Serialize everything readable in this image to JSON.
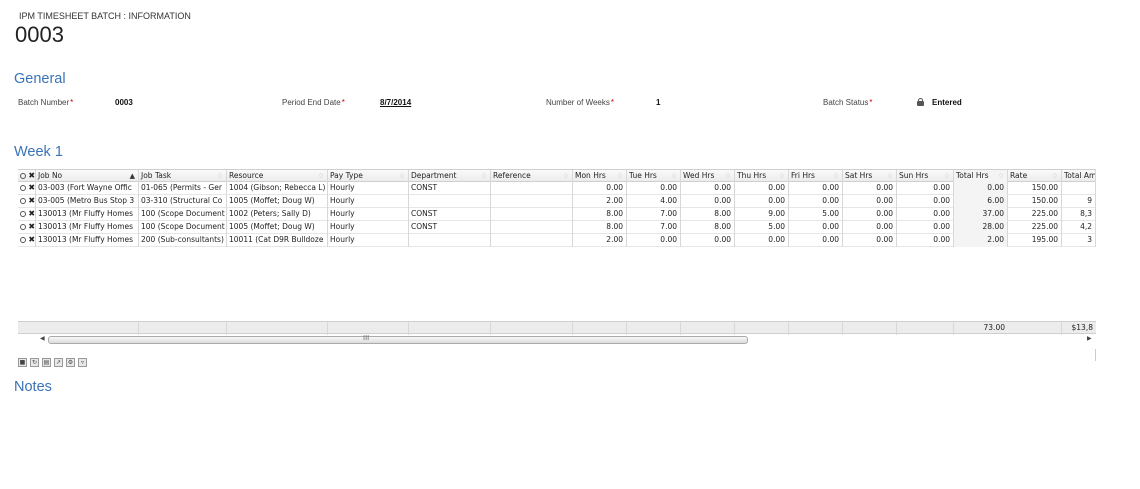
{
  "header": {
    "subtitle": "IPM TIMESHEET BATCH : INFORMATION",
    "title": "0003"
  },
  "general": {
    "section_title": "General",
    "batch_number_label": "Batch Number",
    "batch_number_value": "0003",
    "period_end_label": "Period End Date",
    "period_end_value": "8/7/2014",
    "weeks_label": "Number of Weeks",
    "weeks_value": "1",
    "status_label": "Batch Status",
    "status_value": "Entered",
    "required_marker": "*",
    "status_icon": "lock-icon"
  },
  "week": {
    "section_title": "Week 1",
    "columns": [
      "Job No",
      "Job Task",
      "Resource",
      "Pay Type",
      "Department",
      "Reference",
      "Mon Hrs",
      "Tue Hrs",
      "Wed Hrs",
      "Thu Hrs",
      "Fri Hrs",
      "Sat Hrs",
      "Sun Hrs",
      "Total Hrs",
      "Rate",
      "Total Am"
    ],
    "rows": [
      {
        "job_no": "03-003 (Fort Wayne Offic",
        "job_task": "01-065 (Permits - Ger",
        "resource": "1004 (Gibson; Rebecca L)",
        "pay_type": "Hourly",
        "department": "CONST",
        "reference": "",
        "mon": "0.00",
        "tue": "0.00",
        "wed": "0.00",
        "thu": "0.00",
        "fri": "0.00",
        "sat": "0.00",
        "sun": "0.00",
        "total": "0.00",
        "rate": "150.00",
        "amount": ""
      },
      {
        "job_no": "03-005 (Metro Bus Stop 3",
        "job_task": "03-310 (Structural Co",
        "resource": "1005 (Moffet; Doug W)",
        "pay_type": "Hourly",
        "department": "",
        "reference": "",
        "mon": "2.00",
        "tue": "4.00",
        "wed": "0.00",
        "thu": "0.00",
        "fri": "0.00",
        "sat": "0.00",
        "sun": "0.00",
        "total": "6.00",
        "rate": "150.00",
        "amount": "9"
      },
      {
        "job_no": "130013 (Mr Fluffy Homes",
        "job_task": "100 (Scope Document",
        "resource": "1002 (Peters; Sally D)",
        "pay_type": "Hourly",
        "department": "CONST",
        "reference": "",
        "mon": "8.00",
        "tue": "7.00",
        "wed": "8.00",
        "thu": "9.00",
        "fri": "5.00",
        "sat": "0.00",
        "sun": "0.00",
        "total": "37.00",
        "rate": "225.00",
        "amount": "8,3"
      },
      {
        "job_no": "130013 (Mr Fluffy Homes",
        "job_task": "100 (Scope Document",
        "resource": "1005 (Moffet; Doug W)",
        "pay_type": "Hourly",
        "department": "CONST",
        "reference": "",
        "mon": "8.00",
        "tue": "7.00",
        "wed": "8.00",
        "thu": "5.00",
        "fri": "0.00",
        "sat": "0.00",
        "sun": "0.00",
        "total": "28.00",
        "rate": "225.00",
        "amount": "4,2"
      },
      {
        "job_no": "130013 (Mr Fluffy Homes",
        "job_task": "200 (Sub-consultants)",
        "resource": "10011 (Cat D9R Bulldoze",
        "pay_type": "Hourly",
        "department": "",
        "reference": "",
        "mon": "2.00",
        "tue": "0.00",
        "wed": "0.00",
        "thu": "0.00",
        "fri": "0.00",
        "sat": "0.00",
        "sun": "0.00",
        "total": "2.00",
        "rate": "195.00",
        "amount": "3"
      }
    ],
    "footer": {
      "total_hrs": "73.00",
      "total_amount": "$13,8"
    },
    "scroll_grip": "III",
    "toolbar_icons": [
      "new-row-icon",
      "refresh-icon",
      "print-icon",
      "export-icon",
      "settings-icon",
      "filter-icon"
    ]
  },
  "notes": {
    "section_title": "Notes"
  }
}
